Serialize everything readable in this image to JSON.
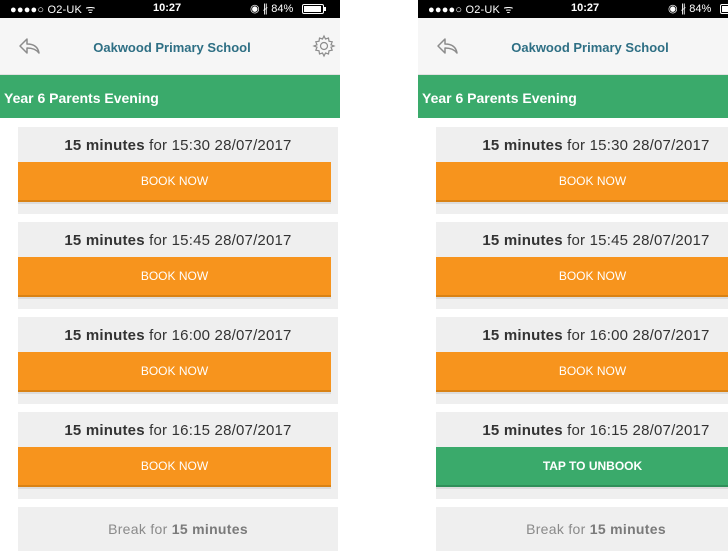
{
  "screens": [
    {
      "status": {
        "carrier": "●●●●○ O2-UK ᯤ",
        "time": "10:27",
        "indicators": "◉ ∦ 84%",
        "battery_level": 0.84
      },
      "nav": {
        "title": "Oakwood Primary School",
        "back_icon": "back-arrow-icon",
        "settings_icon": "gear-icon"
      },
      "header": "Year 6 Parents Evening",
      "slots": [
        {
          "duration": "15 minutes",
          "for": "for",
          "time": "15:30 28/07/2017",
          "action": "BOOK NOW",
          "state": "available"
        },
        {
          "duration": "15 minutes",
          "for": "for",
          "time": "15:45 28/07/2017",
          "action": "BOOK NOW",
          "state": "available"
        },
        {
          "duration": "15 minutes",
          "for": "for",
          "time": "16:00 28/07/2017",
          "action": "BOOK NOW",
          "state": "available"
        },
        {
          "duration": "15 minutes",
          "for": "for",
          "time": "16:15 28/07/2017",
          "action": "BOOK NOW",
          "state": "available"
        }
      ],
      "break": {
        "prefix": "Break for",
        "duration": "15 minutes"
      }
    },
    {
      "status": {
        "carrier": "●●●●○ O2-UK ᯤ",
        "time": "10:27",
        "indicators": "◉ ∦ 84%",
        "battery_level": 0.84
      },
      "nav": {
        "title": "Oakwood Primary School",
        "back_icon": "back-arrow-icon",
        "settings_icon": "gear-icon"
      },
      "header": "Year 6 Parents Evening",
      "slots": [
        {
          "duration": "15 minutes",
          "for": "for",
          "time": "15:30 28/07/2017",
          "action": "BOOK NOW",
          "state": "available"
        },
        {
          "duration": "15 minutes",
          "for": "for",
          "time": "15:45 28/07/2017",
          "action": "BOOK NOW",
          "state": "available"
        },
        {
          "duration": "15 minutes",
          "for": "for",
          "time": "16:00 28/07/2017",
          "action": "BOOK NOW",
          "state": "available"
        },
        {
          "duration": "15 minutes",
          "for": "for",
          "time": "16:15 28/07/2017",
          "action": "TAP TO UNBOOK",
          "state": "booked"
        }
      ],
      "break": {
        "prefix": "Break for",
        "duration": "15 minutes"
      }
    }
  ],
  "colors": {
    "header_green": "#3aaa6b",
    "book_orange": "#f7941d",
    "nav_title_blue": "#2e6f84",
    "slot_bg": "#efefef"
  }
}
